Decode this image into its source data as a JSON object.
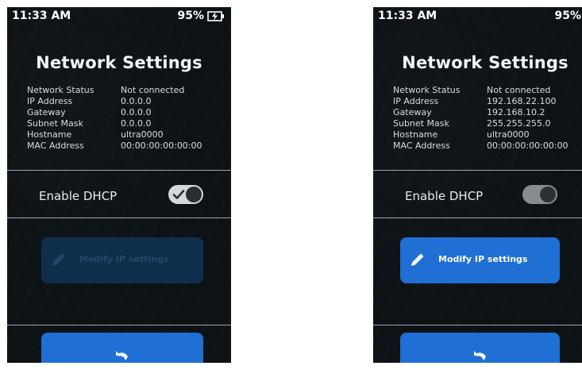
{
  "screens": [
    {
      "statusbar": {
        "time": "11:33 AM",
        "battery": "95%"
      },
      "title": "Network Settings",
      "info": [
        {
          "label": "Network Status",
          "value": "Not connected"
        },
        {
          "label": "IP Address",
          "value": "0.0.0.0"
        },
        {
          "label": "Gateway",
          "value": "0.0.0.0"
        },
        {
          "label": "Subnet Mask",
          "value": "0.0.0.0"
        },
        {
          "label": "Hostname",
          "value": "ultra0000"
        },
        {
          "label": "MAC Address",
          "value": "00:00:00:00:00:00"
        }
      ],
      "dhcp": {
        "label": "Enable DHCP",
        "enabled": true
      },
      "modify": {
        "label": "Modify IP settings",
        "enabled": false
      },
      "back": {
        "icon": "undo-icon"
      }
    },
    {
      "statusbar": {
        "time": "11:33 AM",
        "battery": "95%"
      },
      "title": "Network Settings",
      "info": [
        {
          "label": "Network Status",
          "value": "Not connected"
        },
        {
          "label": "IP Address",
          "value": "192.168.22.100"
        },
        {
          "label": "Gateway",
          "value": "192.168.10.2"
        },
        {
          "label": "Subnet Mask",
          "value": "255.255.255.0"
        },
        {
          "label": "Hostname",
          "value": "ultra0000"
        },
        {
          "label": "MAC Address",
          "value": "00:00:00:00:00:00"
        }
      ],
      "dhcp": {
        "label": "Enable DHCP",
        "enabled": false
      },
      "modify": {
        "label": "Modify IP settings",
        "enabled": true
      },
      "back": {
        "icon": "undo-icon"
      }
    }
  ],
  "colors": {
    "background": "#0d1216",
    "accent": "#1f6fd4",
    "accent_disabled": "#0f2f4c",
    "text": "#e8ecef"
  }
}
